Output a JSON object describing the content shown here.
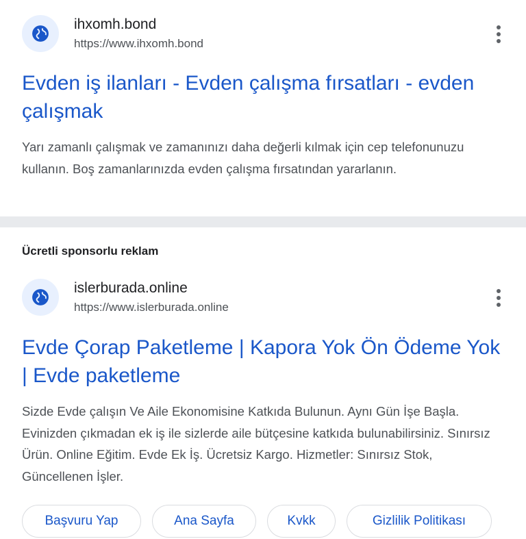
{
  "results": [
    {
      "site_name": "ihxomh.bond",
      "site_url": "https://www.ihxomh.bond",
      "title": "Evden iş ilanları - Evden çalışma fırsatları - evden çalışmak",
      "description": "Yarı zamanlı çalışmak ve zamanınızı daha değerli kılmak için cep telefonunuzu kullanın. Boş zamanlarınızda evden çalışma fırsatından yararlanın."
    },
    {
      "sponsored_label": "Ücretli sponsorlu reklam",
      "site_name": "islerburada.online",
      "site_url": "https://www.islerburada.online",
      "title": "Evde Çorap Paketleme | Kapora Yok Ön Ödeme Yok | Evde paketleme",
      "description": "Sizde Evde çalışın Ve Aile Ekonomisine Katkıda Bulunun. Aynı Gün İşe Başla. Evinizden çıkmadan ek iş ile sizlerde aile bütçesine katkıda bulunabilirsiniz. Sınırsız Ürün. Online Eğitim. Evde Ek İş. Ücretsiz Kargo. Hizmetler: Sınırsız Stok, Güncellenen İşler.",
      "sitelinks": [
        "Başvuru Yap",
        "Ana Sayfa",
        "Kvkk",
        "Gizlilik Politikası"
      ]
    }
  ],
  "colors": {
    "link": "#1a57c9",
    "favicon_bg": "#e8f0fe",
    "favicon_fg": "#1a57c9",
    "divider": "#e8eaed"
  },
  "icons": {
    "favicon": "globe-icon",
    "more": "more-vertical-icon"
  }
}
